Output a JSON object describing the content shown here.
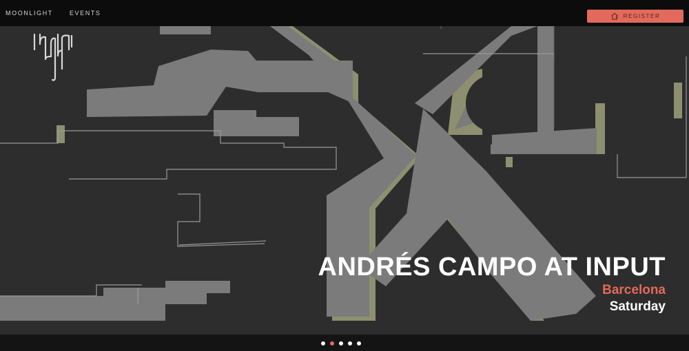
{
  "nav": {
    "items": [
      {
        "label": "MOONLIGHT"
      },
      {
        "label": "EVENTS"
      }
    ]
  },
  "register": {
    "label": "REGISTER",
    "icon": "home-plus-icon"
  },
  "hero": {
    "title": "ANDRÉS CAMPO AT INPUT",
    "city": "Barcelona",
    "day": "Saturday"
  },
  "carousel": {
    "count": 5,
    "active_index": 1
  },
  "colors": {
    "accent": "#e26a5d",
    "background": "#2c2c2c",
    "shape_fill": "#7b7b7b",
    "shape_shadow": "#8c9070"
  }
}
